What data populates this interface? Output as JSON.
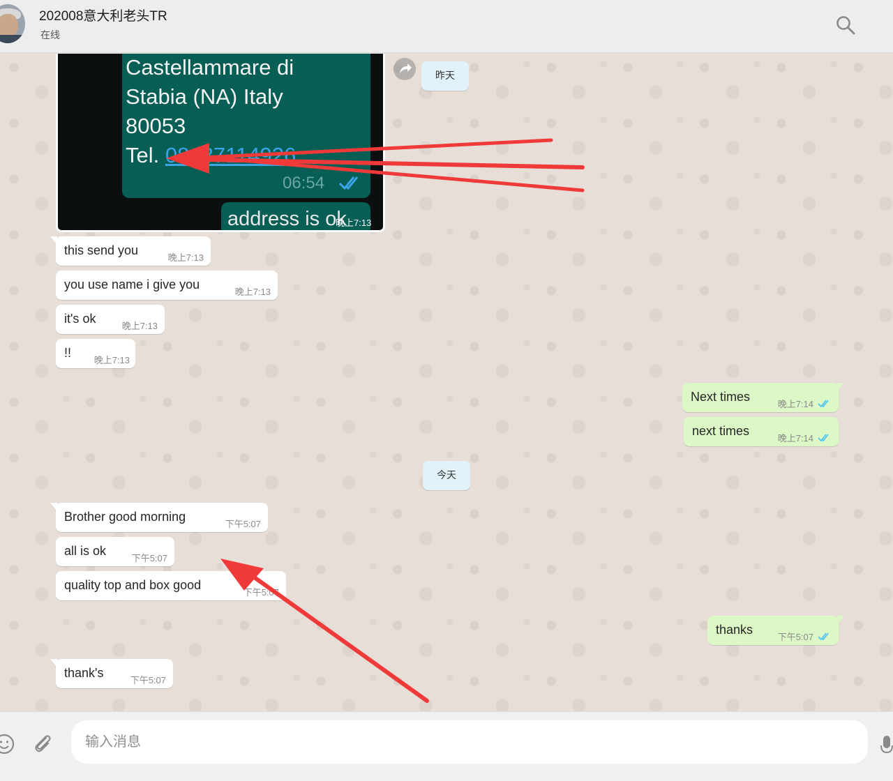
{
  "header": {
    "contact_name": "202008意大利老头TR",
    "status": "在线"
  },
  "image_message": {
    "lines": [
      "Castellammare di",
      "Stabia (NA) Italy",
      "80053"
    ],
    "tel_prefix": "Tel. ",
    "tel_link": "08187114926",
    "card_time": "06:54",
    "second_bubble_text": "address is ok",
    "caption_time": "晚上7:13"
  },
  "dates": {
    "yesterday": "昨天",
    "today": "今天"
  },
  "messages": [
    {
      "dir": "in",
      "text": "this send you",
      "time": "晚上7:13"
    },
    {
      "dir": "in",
      "text": "you use name i give you",
      "time": "晚上7:13"
    },
    {
      "dir": "in",
      "text": "it's ok",
      "time": "晚上7:13"
    },
    {
      "dir": "in",
      "text": "!!",
      "time": "晚上7:13"
    },
    {
      "dir": "out",
      "text": "Next times",
      "time": "晚上7:14",
      "status": "read"
    },
    {
      "dir": "out",
      "text": "next times",
      "time": "晚上7:14",
      "status": "read"
    },
    {
      "dir": "in",
      "text": "Brother good morning",
      "time": "下午5:07"
    },
    {
      "dir": "in",
      "text": "all is ok",
      "time": "下午5:07"
    },
    {
      "dir": "in",
      "text": "quality top and box good",
      "time": "下午5:07"
    },
    {
      "dir": "out",
      "text": "thanks",
      "time": "下午5:07",
      "status": "read"
    },
    {
      "dir": "in",
      "text": "thank's",
      "time": "下午5:07"
    }
  ],
  "composer": {
    "placeholder": "输入消息"
  },
  "icons": {
    "search": "search-icon",
    "forward": "forward-icon",
    "emoji": "emoji-icon",
    "attach": "paperclip-icon",
    "mic": "microphone-icon",
    "read_ticks": "double-check-icon"
  },
  "colors": {
    "chat_bg": "#e6ded7",
    "incoming_bubble": "#ffffff",
    "outgoing_bubble": "#dcf8c6",
    "date_pill": "#e1f2fb",
    "read_ticks": "#4fc3f7",
    "annotation_arrows": "#f03a3a",
    "card_green": "#075e55"
  }
}
